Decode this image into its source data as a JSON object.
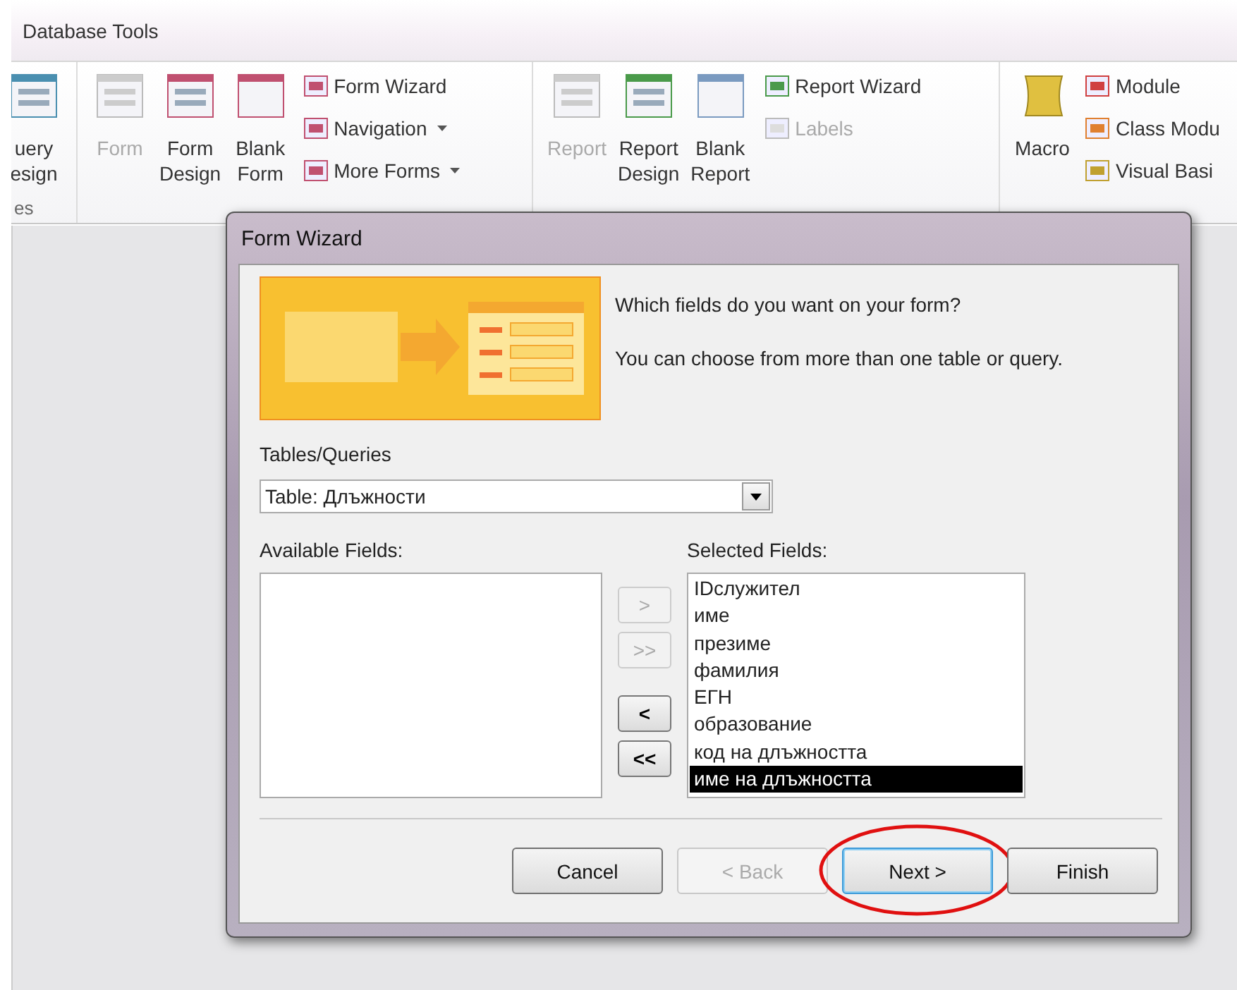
{
  "ribbon": {
    "tab": "Database Tools",
    "groups": [
      {
        "label": "es",
        "large": [
          {
            "lines": [
              "uery",
              "esign"
            ],
            "disabled": false
          }
        ]
      },
      {
        "large": [
          {
            "lines": [
              "Form"
            ],
            "disabled": true
          },
          {
            "lines": [
              "Form",
              "Design"
            ],
            "disabled": false
          },
          {
            "lines": [
              "Blank",
              "Form"
            ],
            "disabled": false
          }
        ],
        "small": [
          {
            "label": "Form Wizard",
            "dropdown": false,
            "disabled": false
          },
          {
            "label": "Navigation",
            "dropdown": true,
            "disabled": false
          },
          {
            "label": "More Forms",
            "dropdown": true,
            "disabled": false
          }
        ]
      },
      {
        "large": [
          {
            "lines": [
              "Report"
            ],
            "disabled": true
          },
          {
            "lines": [
              "Report",
              "Design"
            ],
            "disabled": false
          },
          {
            "lines": [
              "Blank",
              "Report"
            ],
            "disabled": false
          }
        ],
        "small": [
          {
            "label": "Report Wizard",
            "dropdown": false,
            "disabled": false
          },
          {
            "label": "Labels",
            "dropdown": false,
            "disabled": true
          }
        ]
      },
      {
        "large": [
          {
            "kind": "scroll",
            "lines": [
              "Macro"
            ],
            "disabled": false
          }
        ],
        "small": [
          {
            "label": "Module",
            "dropdown": false,
            "disabled": false
          },
          {
            "label": "Class Modu",
            "dropdown": false,
            "disabled": false
          },
          {
            "label": "Visual Basi",
            "dropdown": false,
            "disabled": false
          }
        ]
      }
    ]
  },
  "dialog": {
    "title": "Form Wizard",
    "prompt": [
      "Which fields do you want on your form?",
      "You can choose from more than one table or query."
    ],
    "tables_label": "Tables/Queries",
    "combo_value": "Table: Длъжности",
    "available_label": "Available Fields:",
    "selected_label": "Selected Fields:",
    "move_buttons": [
      {
        "label": ">",
        "disabled": true
      },
      {
        "label": ">>",
        "disabled": true
      },
      {
        "label": "<",
        "disabled": false
      },
      {
        "label": "<<",
        "disabled": false
      }
    ],
    "selected_fields": [
      {
        "label": "IDслужител",
        "selected": false
      },
      {
        "label": "име",
        "selected": false
      },
      {
        "label": "презиме",
        "selected": false
      },
      {
        "label": "фамилия",
        "selected": false
      },
      {
        "label": "ЕГН",
        "selected": false
      },
      {
        "label": "образование",
        "selected": false
      },
      {
        "label": "код на длъжността",
        "selected": false
      },
      {
        "label": "име на длъжността",
        "selected": true
      }
    ],
    "buttons": [
      {
        "label": "Cancel",
        "disabled": false,
        "focused": false,
        "circled": false
      },
      {
        "label": "< Back",
        "disabled": true,
        "focused": false,
        "circled": false
      },
      {
        "label": "Next >",
        "disabled": false,
        "focused": true,
        "circled": true
      },
      {
        "label": "Finish",
        "disabled": false,
        "focused": false,
        "circled": false
      }
    ]
  }
}
